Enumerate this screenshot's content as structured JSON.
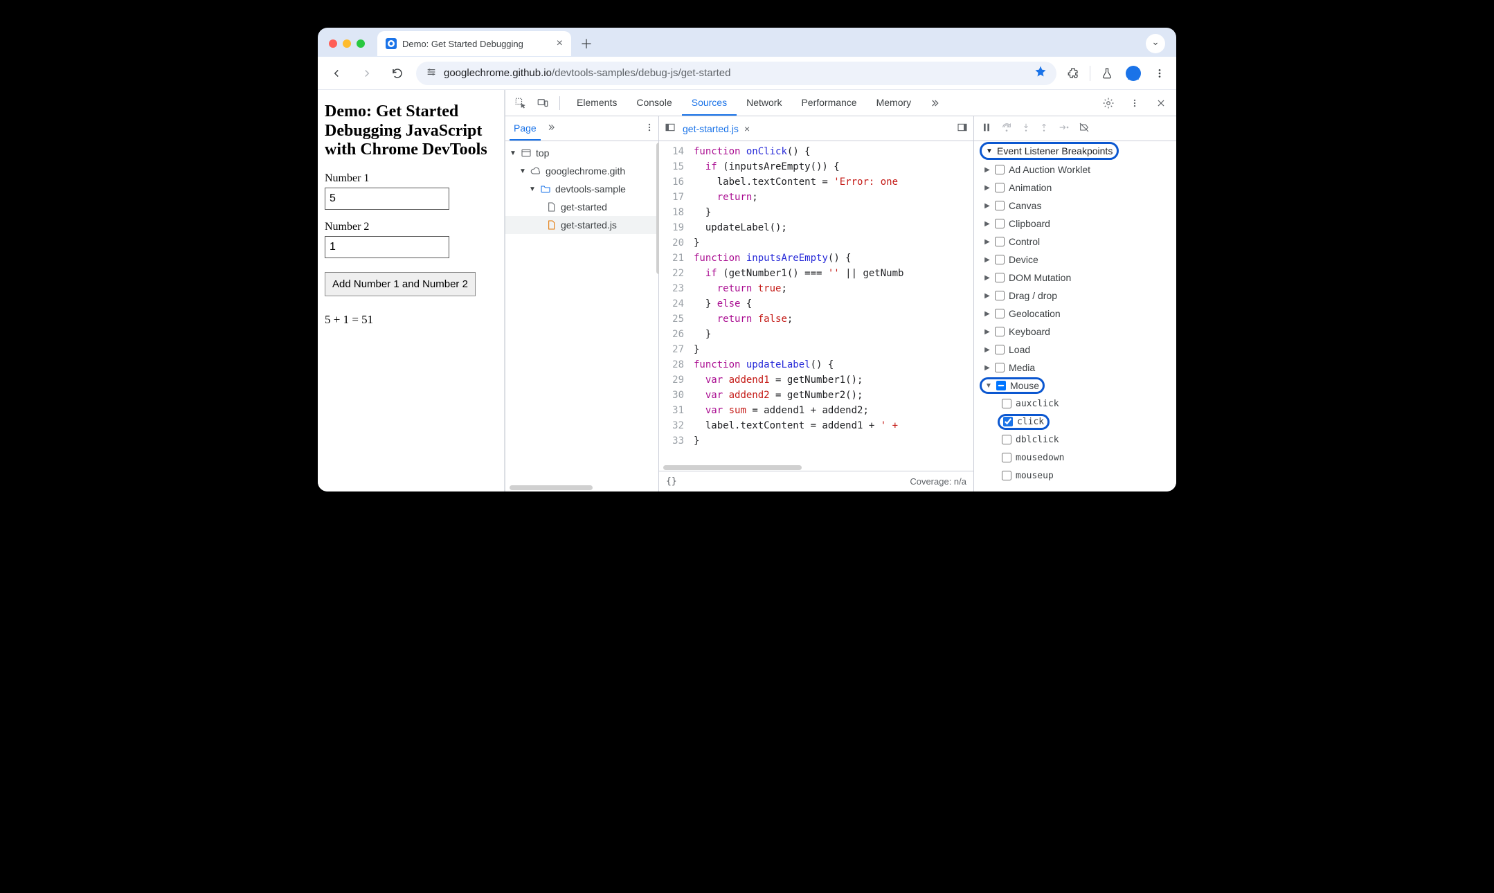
{
  "browser": {
    "tab_title": "Demo: Get Started Debugging",
    "url_host": "googlechrome.github.io",
    "url_path": "/devtools-samples/debug-js/get-started"
  },
  "page": {
    "heading": "Demo: Get Started Debugging JavaScript with Chrome DevTools",
    "label1": "Number 1",
    "value1": "5",
    "label2": "Number 2",
    "value2": "1",
    "button": "Add Number 1 and Number 2",
    "result": "5 + 1 = 51"
  },
  "devtools": {
    "tabs": [
      "Elements",
      "Console",
      "Sources",
      "Network",
      "Performance",
      "Memory"
    ],
    "active_tab": "Sources",
    "nav": {
      "tab": "Page",
      "tree": {
        "top": "top",
        "origin": "googlechrome.gith",
        "folder": "devtools-sample",
        "files": [
          "get-started",
          "get-started.js"
        ],
        "selected": "get-started.js"
      }
    },
    "editor": {
      "open_file": "get-started.js",
      "first_line": 14,
      "lines": [
        {
          "n": 14,
          "html": "<span class='kw'>function</span> <span class='fn'>onClick</span>() {"
        },
        {
          "n": 15,
          "html": "  <span class='kw'>if</span> (inputsAreEmpty()) {"
        },
        {
          "n": 16,
          "html": "    label.textContent = <span class='str'>'Error: one</span>"
        },
        {
          "n": 17,
          "html": "    <span class='kw'>return</span>;"
        },
        {
          "n": 18,
          "html": "  }"
        },
        {
          "n": 19,
          "html": "  updateLabel();"
        },
        {
          "n": 20,
          "html": "}"
        },
        {
          "n": 21,
          "html": "<span class='kw'>function</span> <span class='fn'>inputsAreEmpty</span>() {"
        },
        {
          "n": 22,
          "html": "  <span class='kw'>if</span> (getNumber1() === <span class='str'>''</span> || getNumb"
        },
        {
          "n": 23,
          "html": "    <span class='kw'>return</span> <span class='vr'>true</span>;"
        },
        {
          "n": 24,
          "html": "  } <span class='kw'>else</span> {"
        },
        {
          "n": 25,
          "html": "    <span class='kw'>return</span> <span class='vr'>false</span>;"
        },
        {
          "n": 26,
          "html": "  }"
        },
        {
          "n": 27,
          "html": "}"
        },
        {
          "n": 28,
          "html": "<span class='kw'>function</span> <span class='fn'>updateLabel</span>() {"
        },
        {
          "n": 29,
          "html": "  <span class='kw'>var</span> <span class='vr'>addend1</span> = getNumber1();"
        },
        {
          "n": 30,
          "html": "  <span class='kw'>var</span> <span class='vr'>addend2</span> = getNumber2();"
        },
        {
          "n": 31,
          "html": "  <span class='kw'>var</span> <span class='vr'>sum</span> = addend1 + addend2;"
        },
        {
          "n": 32,
          "html": "  label.textContent = addend1 + <span class='str'>' +</span>"
        },
        {
          "n": 33,
          "html": "}"
        }
      ],
      "status_left": "{}",
      "status_right": "Coverage: n/a"
    },
    "debugger": {
      "panel_title": "Event Listener Breakpoints",
      "categories": [
        {
          "name": "Ad Auction Worklet",
          "checked": false,
          "expanded": false
        },
        {
          "name": "Animation",
          "checked": false,
          "expanded": false
        },
        {
          "name": "Canvas",
          "checked": false,
          "expanded": false
        },
        {
          "name": "Clipboard",
          "checked": false,
          "expanded": false
        },
        {
          "name": "Control",
          "checked": false,
          "expanded": false
        },
        {
          "name": "Device",
          "checked": false,
          "expanded": false
        },
        {
          "name": "DOM Mutation",
          "checked": false,
          "expanded": false
        },
        {
          "name": "Drag / drop",
          "checked": false,
          "expanded": false
        },
        {
          "name": "Geolocation",
          "checked": false,
          "expanded": false
        },
        {
          "name": "Keyboard",
          "checked": false,
          "expanded": false
        },
        {
          "name": "Load",
          "checked": false,
          "expanded": false
        },
        {
          "name": "Media",
          "checked": false,
          "expanded": false
        },
        {
          "name": "Mouse",
          "checked": "mixed",
          "expanded": true,
          "highlight": true,
          "children": [
            {
              "name": "auxclick",
              "checked": false
            },
            {
              "name": "click",
              "checked": true,
              "highlight": true
            },
            {
              "name": "dblclick",
              "checked": false
            },
            {
              "name": "mousedown",
              "checked": false
            },
            {
              "name": "mouseup",
              "checked": false
            }
          ]
        }
      ]
    }
  }
}
